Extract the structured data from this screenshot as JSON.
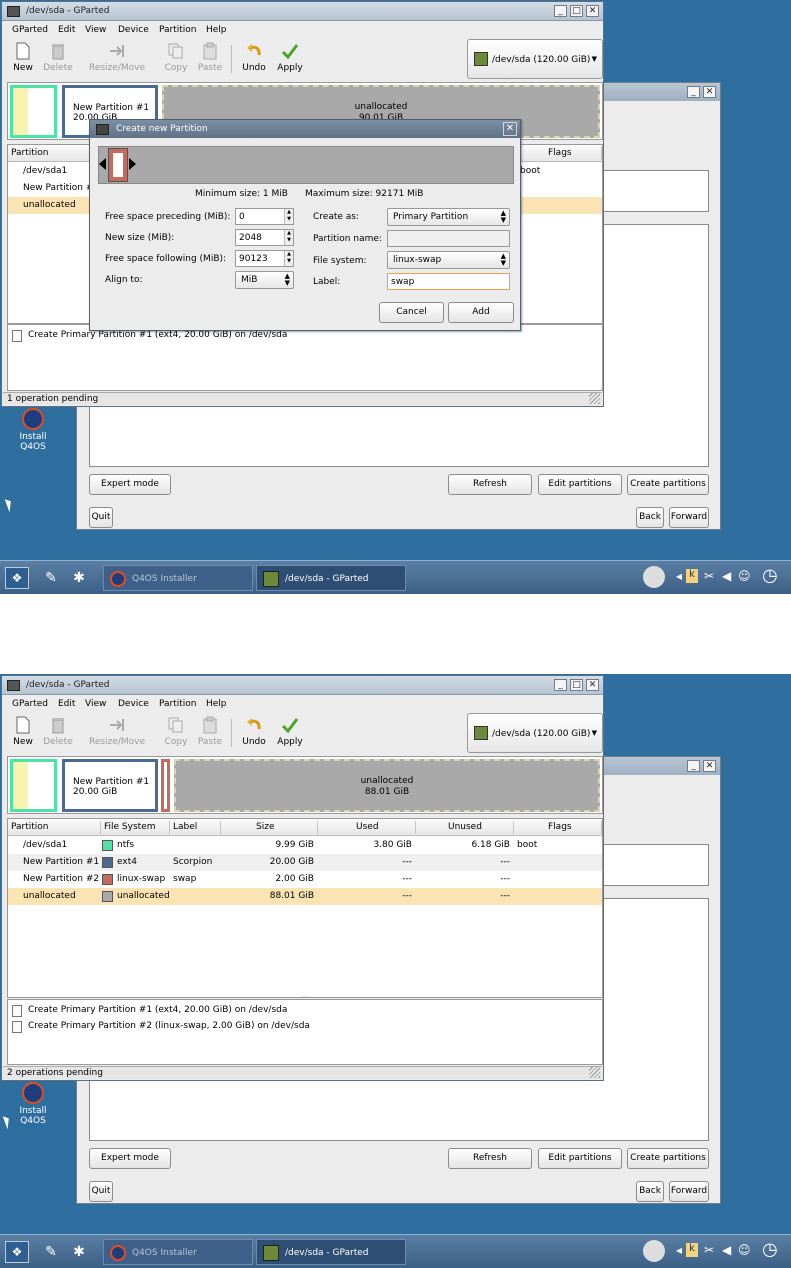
{
  "screens": [
    {
      "gparted": {
        "title": "/dev/sda - GParted",
        "menu": [
          "GParted",
          "Edit",
          "View",
          "Device",
          "Partition",
          "Help"
        ],
        "toolbar": {
          "new": "New",
          "delete": "Delete",
          "resize": "Resize/Move",
          "copy": "Copy",
          "paste": "Paste",
          "undo": "Undo",
          "apply": "Apply"
        },
        "device": "/dev/sda   (120.00 GiB)",
        "diskmap": {
          "part1_name": "New Partition #1",
          "part1_size": "20.00 GiB",
          "unalloc_name": "unallocated",
          "unalloc_size": "90.01 GiB"
        },
        "columns": [
          "Partition",
          "Flags"
        ],
        "rows": [
          {
            "partition": "/dev/sda1",
            "flags": "boot"
          },
          {
            "partition": "New Partition #1"
          },
          {
            "partition": "unallocated"
          }
        ],
        "operations": [
          "Create Primary Partition #1 (ext4, 20.00 GiB) on /dev/sda"
        ],
        "status": "1 operation pending"
      },
      "dialog": {
        "title": "Create new Partition",
        "min_size": "Minimum size: 1 MiB",
        "max_size": "Maximum size: 92171 MiB",
        "free_preceding_label": "Free space preceding (MiB):",
        "free_preceding": "0",
        "new_size_label": "New size (MiB):",
        "new_size": "2048",
        "free_following_label": "Free space following (MiB):",
        "free_following": "90123",
        "align_label": "Align to:",
        "align": "MiB",
        "create_as_label": "Create as:",
        "create_as": "Primary Partition",
        "partition_name_label": "Partition name:",
        "partition_name": "",
        "filesystem_label": "File system:",
        "filesystem": "linux-swap",
        "label_label": "Label:",
        "label": "swap",
        "cancel": "Cancel",
        "add": "Add"
      },
      "installer": {
        "expert_mode": "Expert mode",
        "refresh": "Refresh",
        "edit_partitions": "Edit partitions",
        "create_partitions": "Create partitions",
        "quit": "Quit",
        "back": "Back",
        "forward": "Forward"
      },
      "desktop": {
        "icon_label_1": "Install",
        "icon_label_2": "Q4OS"
      },
      "taskbar": {
        "task1": "Q4OS Installer",
        "task2": "/dev/sda - GParted"
      }
    },
    {
      "gparted": {
        "title": "/dev/sda - GParted",
        "menu": [
          "GParted",
          "Edit",
          "View",
          "Device",
          "Partition",
          "Help"
        ],
        "toolbar": {
          "new": "New",
          "delete": "Delete",
          "resize": "Resize/Move",
          "copy": "Copy",
          "paste": "Paste",
          "undo": "Undo",
          "apply": "Apply"
        },
        "device": "/dev/sda   (120.00 GiB)",
        "diskmap": {
          "part1_name": "New Partition #1",
          "part1_size": "20.00 GiB",
          "unalloc_name": "unallocated",
          "unalloc_size": "88.01 GiB"
        },
        "columns": [
          "Partition",
          "File System",
          "Label",
          "Size",
          "Used",
          "Unused",
          "Flags"
        ],
        "rows": [
          {
            "partition": "/dev/sda1",
            "fs": "ntfs",
            "fs_color": "#4de3a8",
            "label": "",
            "size": "9.99 GiB",
            "used": "3.80 GiB",
            "unused": "6.18 GiB",
            "flags": "boot"
          },
          {
            "partition": "New Partition #1",
            "fs": "ext4",
            "fs_color": "#4a6a94",
            "label": "Scorpion",
            "size": "20.00 GiB",
            "used": "---",
            "unused": "---",
            "flags": ""
          },
          {
            "partition": "New Partition #2",
            "fs": "linux-swap",
            "fs_color": "#c56b5e",
            "label": "swap",
            "size": "2.00 GiB",
            "used": "---",
            "unused": "---",
            "flags": ""
          },
          {
            "partition": "unallocated",
            "fs": "unallocated",
            "fs_color": "#a9a9a9",
            "label": "",
            "size": "88.01 GiB",
            "used": "---",
            "unused": "---",
            "flags": ""
          }
        ],
        "operations": [
          "Create Primary Partition #1 (ext4, 20.00 GiB) on /dev/sda",
          "Create Primary Partition #2 (linux-swap, 2.00 GiB) on /dev/sda"
        ],
        "status": "2 operations pending"
      },
      "installer": {
        "expert_mode": "Expert mode",
        "refresh": "Refresh",
        "edit_partitions": "Edit partitions",
        "create_partitions": "Create partitions",
        "quit": "Quit",
        "back": "Back",
        "forward": "Forward"
      },
      "desktop": {
        "icon_label_1": "Install",
        "icon_label_2": "Q4OS"
      },
      "taskbar": {
        "task1": "Q4OS Installer",
        "task2": "/dev/sda - GParted"
      }
    }
  ]
}
